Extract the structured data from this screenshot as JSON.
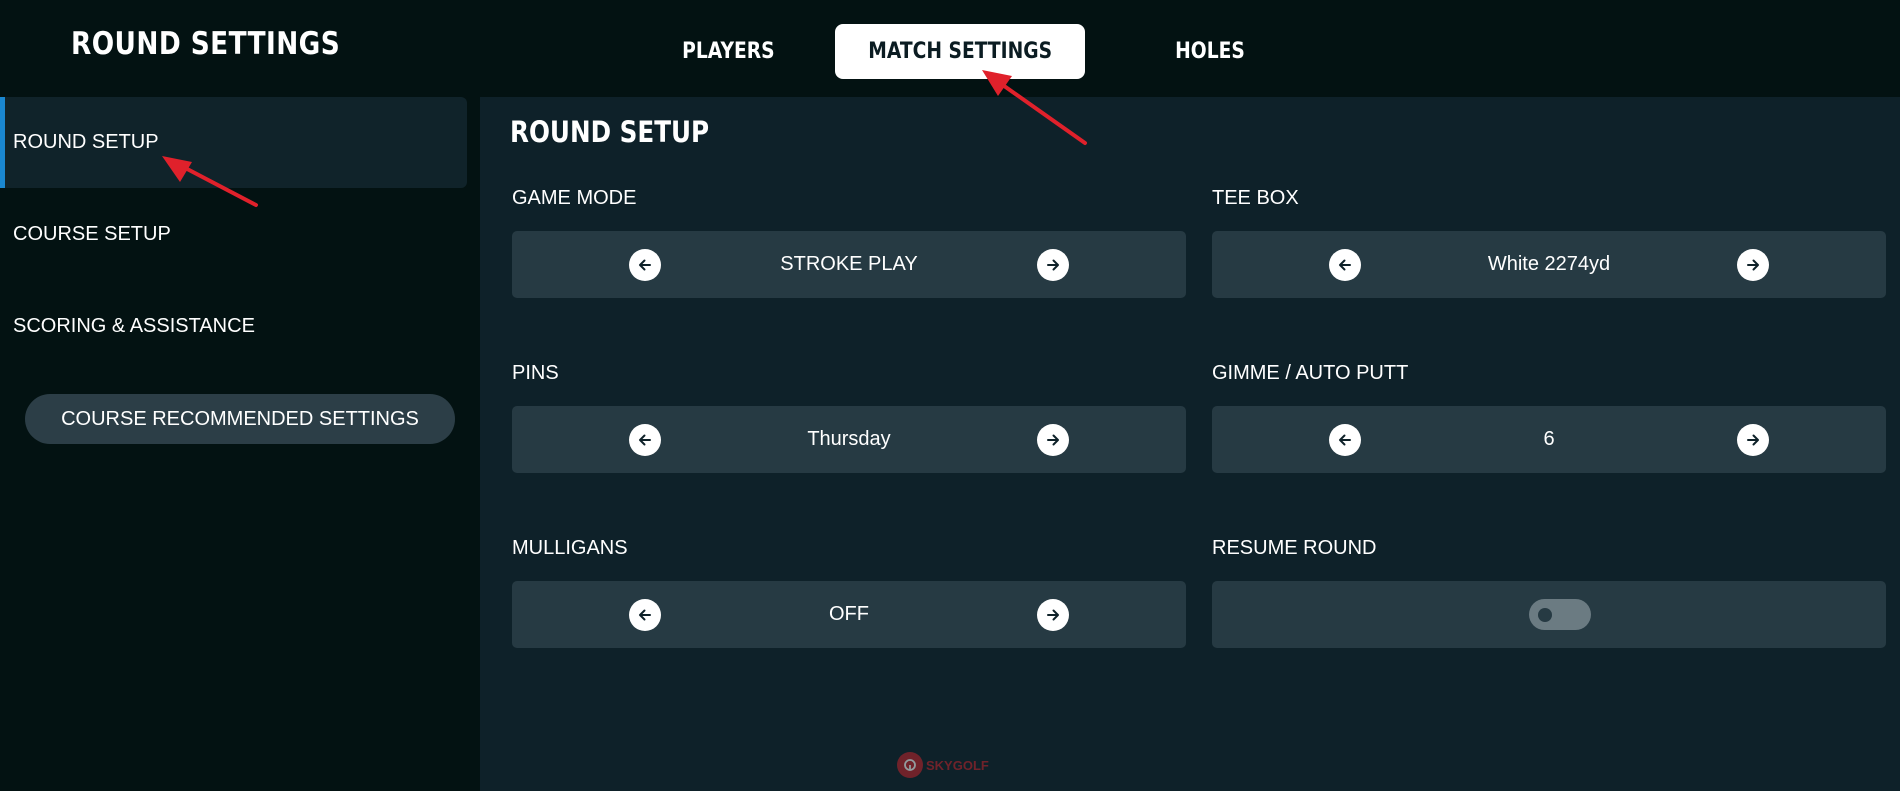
{
  "header": {
    "title": "ROUND SETTINGS",
    "tabs": [
      {
        "label": "PLAYERS",
        "active": false
      },
      {
        "label": "MATCH SETTINGS",
        "active": true
      },
      {
        "label": "HOLES",
        "active": false
      }
    ]
  },
  "sidebar": {
    "items": [
      {
        "label": "ROUND SETUP",
        "active": true
      },
      {
        "label": "COURSE SETUP",
        "active": false
      },
      {
        "label": "SCORING & ASSISTANCE",
        "active": false
      }
    ],
    "recommended_button": "COURSE RECOMMENDED SETTINGS"
  },
  "main": {
    "title": "ROUND SETUP",
    "settings": [
      {
        "label": "GAME MODE",
        "value": "STROKE PLAY"
      },
      {
        "label": "TEE BOX",
        "value": "White 2274yd"
      },
      {
        "label": "PINS",
        "value": "Thursday"
      },
      {
        "label": "GIMME / AUTO PUTT",
        "value": "6"
      },
      {
        "label": "MULLIGANS",
        "value": "OFF"
      },
      {
        "label": "RESUME ROUND",
        "toggle_on": false
      }
    ]
  },
  "watermark": {
    "text": "SKYGOLF"
  },
  "icons": {
    "left_arrow": "arrow-left-icon",
    "right_arrow": "arrow-right-icon",
    "annotation": "red-annotation-arrow"
  },
  "colors": {
    "accent": "#1a87d0",
    "background": "#061616",
    "panel": "#0e2129",
    "selector": "#263a43",
    "annotation": "#e0212b"
  }
}
